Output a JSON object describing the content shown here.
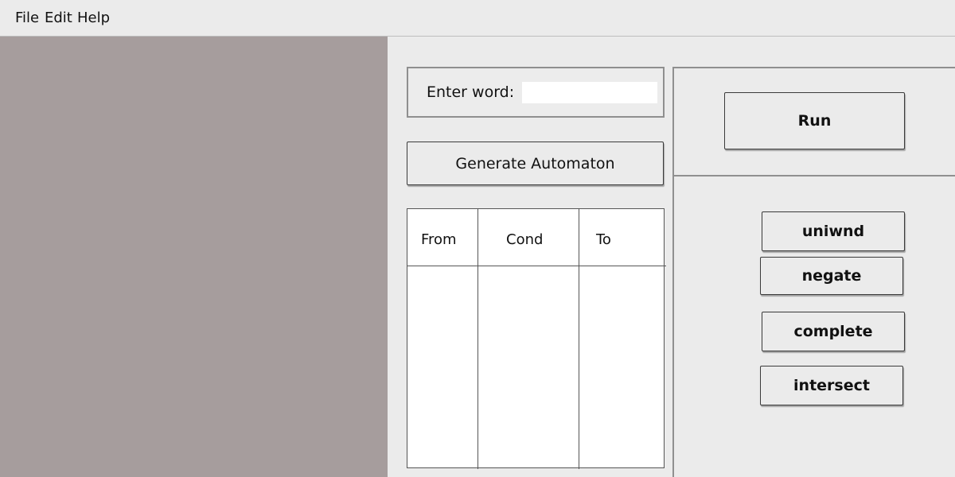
{
  "menu": {
    "file": "File",
    "edit": "Edit",
    "help": "Help"
  },
  "word_entry": {
    "label": "Enter word:",
    "value": "",
    "placeholder": ""
  },
  "generate_button": "Generate Automaton",
  "transition_table": {
    "columns": [
      "From",
      "Cond",
      "To"
    ],
    "rows": []
  },
  "run_button": "Run",
  "operations": [
    "uniwnd",
    "negate",
    "complete",
    "intersect"
  ],
  "colors": {
    "canvas_background": "#a69d9d",
    "window_background": "#ebebeb"
  }
}
